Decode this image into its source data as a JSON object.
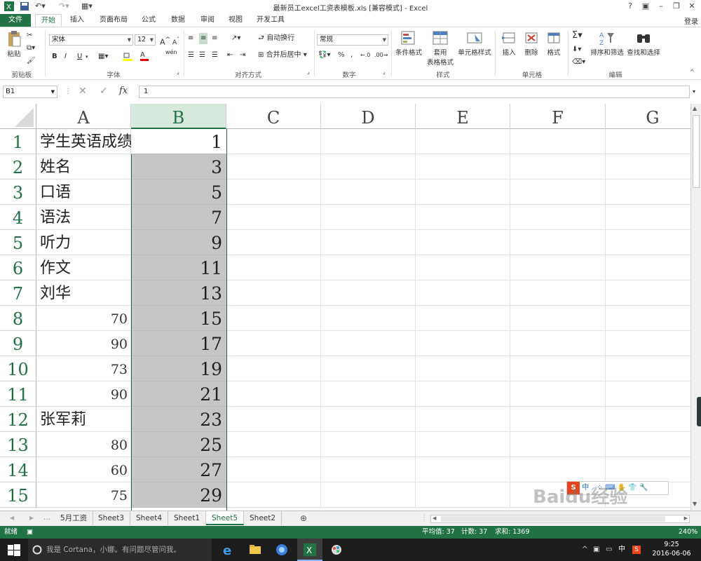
{
  "window": {
    "title": "最新员工excel工资表模板.xls  [兼容模式] - Excel",
    "help": "?",
    "login": "登录"
  },
  "tabs": [
    "文件",
    "开始",
    "插入",
    "页面布局",
    "公式",
    "数据",
    "审阅",
    "视图",
    "开发工具"
  ],
  "ribbon": {
    "clipboard": {
      "label": "剪贴板",
      "paste": "粘贴"
    },
    "font": {
      "label": "字体",
      "name": "宋体",
      "size": "12",
      "bold": "B",
      "italic": "I",
      "underline": "U",
      "grow": "A",
      "shrink": "A",
      "font_color_glyph": "A",
      "wen": "wén"
    },
    "alignment": {
      "label": "对齐方式",
      "wrap": "自动换行",
      "merge": "合并后居中"
    },
    "number": {
      "label": "数字",
      "format": "常规",
      "percent": "%",
      "comma": ","
    },
    "styles": {
      "label": "样式",
      "conditional": "条件格式",
      "table1": "套用",
      "table2": "表格格式",
      "cell_styles": "单元格样式"
    },
    "cells": {
      "label": "单元格",
      "insert": "插入",
      "delete": "删除",
      "format": "格式"
    },
    "editing": {
      "label": "编辑",
      "sort": "排序和筛选",
      "find": "查找和选择"
    }
  },
  "formula_bar": {
    "name_box": "B1",
    "fx": "fx",
    "value": "1"
  },
  "columns": [
    "A",
    "B",
    "C",
    "D",
    "E",
    "F",
    "G"
  ],
  "rows": [
    {
      "n": "1",
      "a": "学生英语成绩",
      "a_type": "txt",
      "b": "1"
    },
    {
      "n": "2",
      "a": "姓名",
      "a_type": "txt",
      "b": "3"
    },
    {
      "n": "3",
      "a": "口语",
      "a_type": "txt",
      "b": "5"
    },
    {
      "n": "4",
      "a": "语法",
      "a_type": "txt",
      "b": "7"
    },
    {
      "n": "5",
      "a": "听力",
      "a_type": "txt",
      "b": "9"
    },
    {
      "n": "6",
      "a": "作文",
      "a_type": "txt",
      "b": "11"
    },
    {
      "n": "7",
      "a": "刘华",
      "a_type": "txt",
      "b": "13"
    },
    {
      "n": "8",
      "a": "70",
      "a_type": "num",
      "b": "15"
    },
    {
      "n": "9",
      "a": "90",
      "a_type": "num",
      "b": "17"
    },
    {
      "n": "10",
      "a": "73",
      "a_type": "num",
      "b": "19"
    },
    {
      "n": "11",
      "a": "90",
      "a_type": "num",
      "b": "21"
    },
    {
      "n": "12",
      "a": "张军莉",
      "a_type": "txt",
      "b": "23"
    },
    {
      "n": "13",
      "a": "80",
      "a_type": "num",
      "b": "25"
    },
    {
      "n": "14",
      "a": "60",
      "a_type": "num",
      "b": "27"
    },
    {
      "n": "15",
      "a": "75",
      "a_type": "num",
      "b": "29"
    }
  ],
  "sheets": [
    "5月工资",
    "Sheet3",
    "Sheet4",
    "Sheet1",
    "Sheet5",
    "Sheet2"
  ],
  "active_sheet": "Sheet5",
  "status": {
    "ready": "就绪",
    "average": "平均值: 37",
    "count": "计数: 37",
    "sum": "求和: 1369",
    "zoom": "240%"
  },
  "taskbar": {
    "cortana": "我是 Cortana，小娜。有问题尽管问我。",
    "ime": "中",
    "time": "9:25",
    "date": "2016-06-06"
  },
  "watermark": "Baidu经验 jingyan.baidu.com",
  "colors": {
    "excel_green": "#217346",
    "selection_gray": "#c6c6c6",
    "header_sel": "#d6e9dc"
  }
}
